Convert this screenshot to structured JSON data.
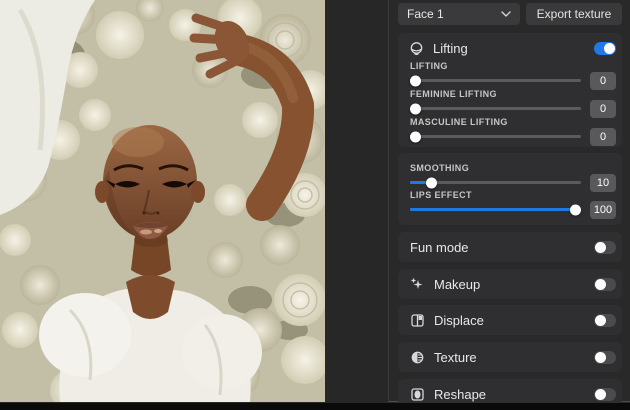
{
  "colors": {
    "accent_blue": "#2278e6",
    "slider_fill": "#1f7ae0",
    "panel_bg": "#29292a",
    "card_bg": "#2f2f31"
  },
  "toolbar": {
    "face_select_value": "Face 1",
    "face_select_icon": "chevron-down-icon",
    "export_button_label": "Export texture"
  },
  "lifting": {
    "title": "Lifting",
    "icon": "face-lift-icon",
    "enabled": true,
    "sliders": [
      {
        "label": "LIFTING",
        "value": "0",
        "percent": 0
      },
      {
        "label": "FEMININE LIFTING",
        "value": "0",
        "percent": 0
      },
      {
        "label": "MASCULINE LIFTING",
        "value": "0",
        "percent": 0
      }
    ]
  },
  "smoothing_group": {
    "sliders": [
      {
        "label": "SMOOTHING",
        "value": "10",
        "percent": 10
      },
      {
        "label": "LIPS EFFECT",
        "value": "100",
        "percent": 100
      }
    ]
  },
  "sections": [
    {
      "label": "Fun mode",
      "icon": "",
      "enabled": false
    },
    {
      "label": "Makeup",
      "icon": "makeup-icon",
      "enabled": false
    },
    {
      "label": "Displace",
      "icon": "displace-icon",
      "enabled": false
    },
    {
      "label": "Texture",
      "icon": "texture-icon",
      "enabled": false
    },
    {
      "label": "Reshape",
      "icon": "reshape-icon",
      "enabled": false
    }
  ]
}
